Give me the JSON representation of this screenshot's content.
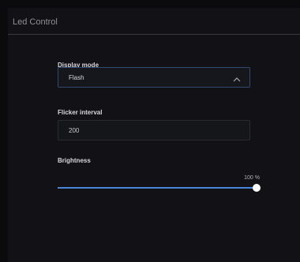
{
  "panel": {
    "title": "Led Control"
  },
  "display_mode": {
    "label": "Display mode",
    "selected": "Flash",
    "chevron_icon": "chevron-up-icon"
  },
  "flicker_interval": {
    "label": "Flicker interval",
    "value": "200"
  },
  "brightness": {
    "label": "Brightness",
    "readout": "100 %",
    "level_fraction": 1.0
  },
  "colors": {
    "accent": "#4a86d6",
    "panel_bg": "#121216",
    "page_bg": "#0b0b0e"
  }
}
